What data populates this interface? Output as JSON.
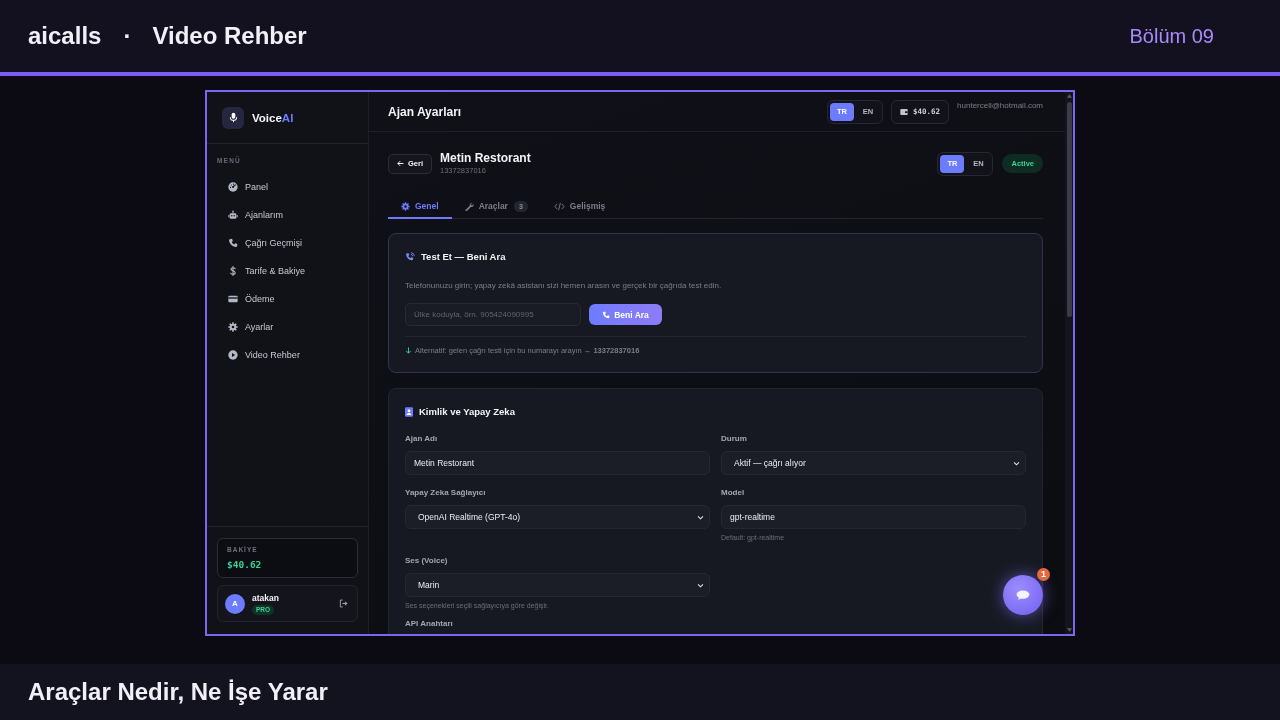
{
  "header": {
    "brand": "aicalls",
    "separator": "·",
    "title": "Video Rehber",
    "episode": "Bölüm 09"
  },
  "app": {
    "sidebar": {
      "logo": {
        "text": "Voice",
        "accent": "AI"
      },
      "menu_label": "MENÜ",
      "items": [
        {
          "label": "Panel",
          "selected": false
        },
        {
          "label": "Ajanlarım",
          "selected": false
        },
        {
          "label": "Çağrı Geçmişi",
          "selected": false
        },
        {
          "label": "Tarife & Bakiye",
          "selected": false
        },
        {
          "label": "Ödeme",
          "selected": false
        },
        {
          "label": "Ayarlar",
          "selected": false
        },
        {
          "label": "Video Rehber",
          "selected": false
        }
      ],
      "balance": {
        "label": "BAKİYE",
        "value": "$40.62"
      },
      "user": {
        "initial": "A",
        "name": "atakan",
        "plan": "PRO"
      }
    },
    "topbar": {
      "title": "Ajan Ayarları",
      "languages": [
        {
          "label": "TR",
          "selected": true
        },
        {
          "label": "EN",
          "selected": false
        }
      ],
      "balance": "$40.62",
      "email": "huntercell@hotmail.com"
    },
    "agent": {
      "back_button": "Geri",
      "name": "Metin Restorant",
      "phone": "13372837016",
      "languages": [
        {
          "label": "TR",
          "selected": true
        },
        {
          "label": "EN",
          "selected": false
        }
      ],
      "status": "Active"
    },
    "tabs": [
      {
        "label": "Genel",
        "selected": true
      },
      {
        "label": "Araçlar",
        "count": "3",
        "selected": false
      },
      {
        "label": "Gelişmiş",
        "selected": false
      }
    ],
    "test_card": {
      "title": "Test Et — Beni Ara",
      "description": "Telefonunuzu girin; yapay zekâ asistanı sizi hemen arasın ve gerçek bir çağrıda test edin.",
      "phone_field": {
        "placeholder": "Ülke koduyla, örn. 905424090995"
      },
      "call_button": "Beni Ara",
      "alternative": "Alternatif: gelen çağrı testi için bu numarayı arayın → **13372837016**"
    },
    "identity_card": {
      "title": "Kimlik ve Yapay Zeka",
      "fields": [
        {
          "label": "Ajan Adı",
          "kind": "input",
          "value": "Metin Restorant"
        },
        {
          "label": "Durum",
          "kind": "select",
          "value": "Aktif — çağrı alıyor"
        },
        {
          "label": "Yapay Zeka Sağlayıcı",
          "kind": "select",
          "value": "OpenAI Realtime (GPT-4o)"
        },
        {
          "label": "Model",
          "kind": "input",
          "value": "gpt-realtime",
          "hint": "Default: gpt-realtime"
        },
        {
          "label": "Ses (Voice)",
          "kind": "select",
          "value": "Marin",
          "hint": "Ses seçenekleri seçili sağlayıcıya göre değişir."
        }
      ],
      "next_section": "API Anahtarı"
    },
    "chat_button": {
      "badge": "1"
    }
  },
  "footer": {
    "title": "Araçlar Nedir, Ne İşe Yarar"
  }
}
